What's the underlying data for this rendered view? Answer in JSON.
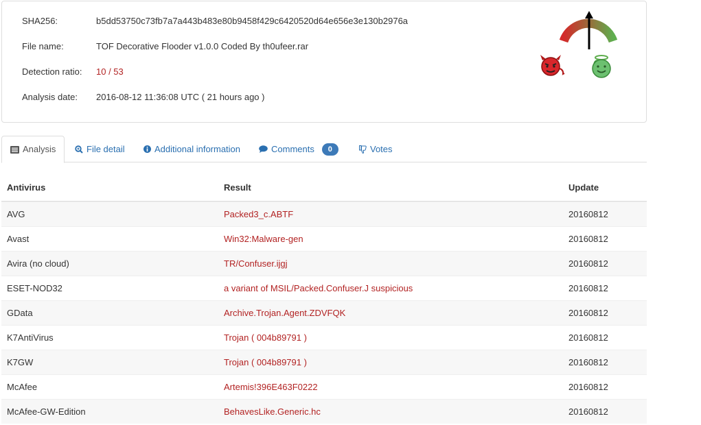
{
  "summary": {
    "sha256_label": "SHA256:",
    "sha256_value": "b5dd53750c73fb7a7a443b483e80b9458f429c6420520d64e656e3e130b2976a",
    "filename_label": "File name:",
    "filename_value": "TOF Decorative Flooder v1.0.0 Coded By th0ufeer.rar",
    "ratio_label": "Detection ratio:",
    "ratio_value": "10 / 53",
    "date_label": "Analysis date:",
    "date_value": "2016-08-12 11:36:08 UTC ( 21 hours ago )"
  },
  "votes": {
    "malicious_count": "0",
    "harmless_count": "0",
    "malicious_icon": "devil-face-icon",
    "harmless_icon": "angel-face-icon"
  },
  "colors": {
    "link": "#2a6fb0",
    "detection": "#b22222",
    "malicious": "#c8102e",
    "harmless": "#3a9c3a",
    "badge": "#3d7ab8"
  },
  "tabs": [
    {
      "label": "Analysis",
      "icon": "list-icon",
      "active": true
    },
    {
      "label": "File detail",
      "icon": "zoom-icon"
    },
    {
      "label": "Additional information",
      "icon": "info-icon"
    },
    {
      "label": "Comments",
      "icon": "comment-icon",
      "badge": "0"
    },
    {
      "label": "Votes",
      "icon": "thumbs-down-icon"
    }
  ],
  "table": {
    "headers": [
      "Antivirus",
      "Result",
      "Update"
    ],
    "rows": [
      {
        "av": "AVG",
        "result": "Packed3_c.ABTF",
        "update": "20160812"
      },
      {
        "av": "Avast",
        "result": "Win32:Malware-gen",
        "update": "20160812"
      },
      {
        "av": "Avira (no cloud)",
        "result": "TR/Confuser.ijgj",
        "update": "20160812"
      },
      {
        "av": "ESET-NOD32",
        "result": "a variant of MSIL/Packed.Confuser.J suspicious",
        "update": "20160812"
      },
      {
        "av": "GData",
        "result": "Archive.Trojan.Agent.ZDVFQK",
        "update": "20160812"
      },
      {
        "av": "K7AntiVirus",
        "result": "Trojan ( 004b89791 )",
        "update": "20160812"
      },
      {
        "av": "K7GW",
        "result": "Trojan ( 004b89791 )",
        "update": "20160812"
      },
      {
        "av": "McAfee",
        "result": "Artemis!396E463F0222",
        "update": "20160812"
      },
      {
        "av": "McAfee-GW-Edition",
        "result": "BehavesLike.Generic.hc",
        "update": "20160812"
      }
    ]
  }
}
